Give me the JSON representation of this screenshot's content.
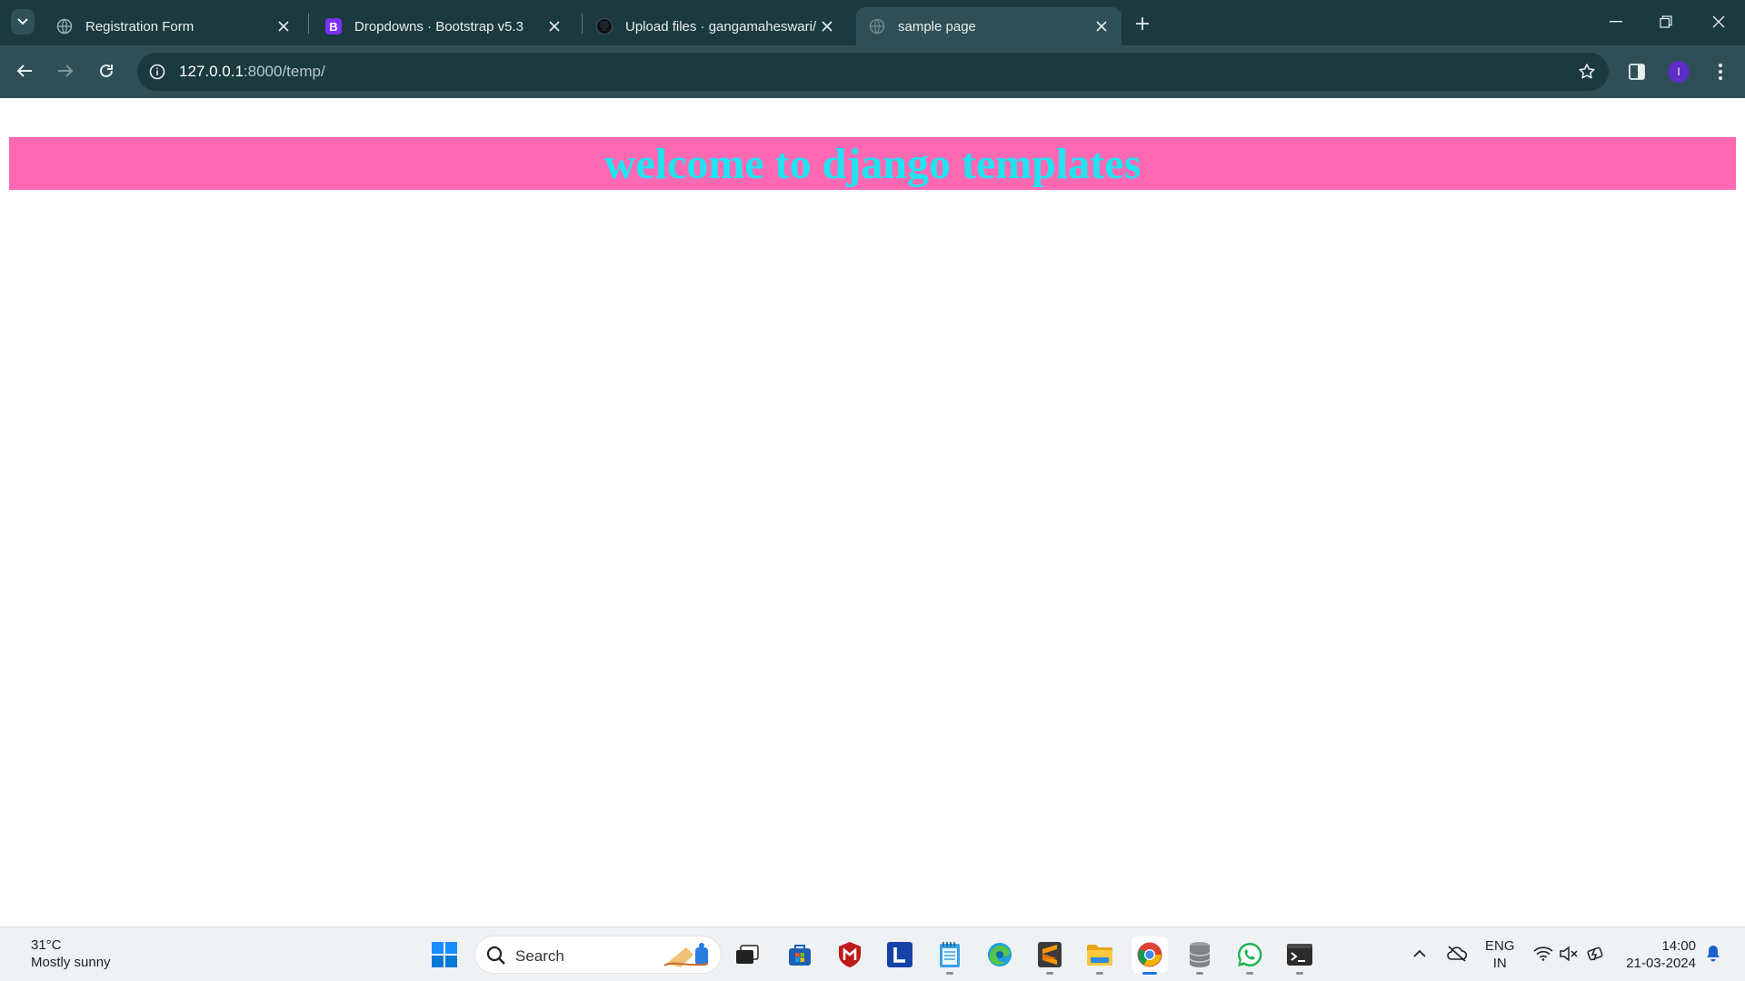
{
  "browser": {
    "tabs": [
      {
        "title": "Registration Form",
        "favicon": "globe-icon",
        "active": false
      },
      {
        "title": "Dropdowns · Bootstrap v5.3",
        "favicon": "bootstrap-icon",
        "active": false
      },
      {
        "title": "Upload files · gangamaheswari/",
        "favicon": "github-icon",
        "active": false
      },
      {
        "title": "sample page",
        "favicon": "globe-icon",
        "active": true
      }
    ],
    "address": {
      "host": "127.0.0.1",
      "rest": ":8000/temp/"
    },
    "profile_initial": "I"
  },
  "page": {
    "heading": "welcome to django templates",
    "banner_bg": "#ff69b4",
    "heading_color": "#1ee3f0"
  },
  "taskbar": {
    "weather": {
      "temp": "31°C",
      "condition": "Mostly sunny"
    },
    "search_placeholder": "Search",
    "lang": {
      "line1": "ENG",
      "line2": "IN"
    },
    "clock": {
      "time": "14:00",
      "date": "21-03-2024"
    }
  },
  "colors": {
    "tabstrip": "#1b3a40",
    "toolbar": "#2e4f55",
    "chrome_accent": "#1a73e8"
  }
}
